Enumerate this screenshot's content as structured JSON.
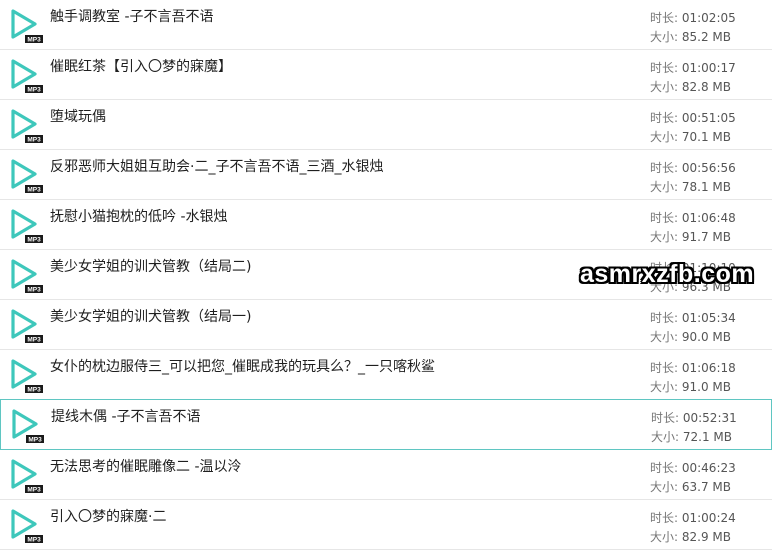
{
  "labels": {
    "duration": "时长: ",
    "size": "大小: "
  },
  "icon_badge": "MP3",
  "colors": {
    "accent": "#3ec7bb",
    "badge": "#1a1a1a",
    "selected_border": "#5fc6c2"
  },
  "files": [
    {
      "name": "触手调教室 -子不言吾不语",
      "duration": "01:02:05",
      "size": "85.2 MB"
    },
    {
      "name": "催眠红茶【引入〇梦的寐魔】",
      "duration": "01:00:17",
      "size": "82.8 MB"
    },
    {
      "name": "堕域玩偶",
      "duration": "00:51:05",
      "size": "70.1 MB"
    },
    {
      "name": "反邪恶师大姐姐互助会·二_子不言吾不语_三酒_水银烛",
      "duration": "00:56:56",
      "size": "78.1 MB"
    },
    {
      "name": "抚慰小猫抱枕的低吟 -水银烛",
      "duration": "01:06:48",
      "size": "91.7 MB"
    },
    {
      "name": "美少女学姐的训犬管教（结局二)",
      "duration": "01:10:10",
      "size": "96.3 MB"
    },
    {
      "name": "美少女学姐的训犬管教（结局一)",
      "duration": "01:05:34",
      "size": "90.0 MB"
    },
    {
      "name": "女仆的枕边服侍三_可以把您_催眠成我的玩具么？_一只喀秋鲨",
      "duration": "01:06:18",
      "size": "91.0 MB"
    },
    {
      "name": "提线木偶 -子不言吾不语",
      "duration": "00:52:31",
      "size": "72.1 MB",
      "selected": true
    },
    {
      "name": "无法思考的催眠雕像二 -温以泠",
      "duration": "00:46:23",
      "size": "63.7 MB"
    },
    {
      "name": "引入〇梦的寐魔·二",
      "duration": "01:00:24",
      "size": "82.9 MB"
    }
  ],
  "watermark": "asmrxzfb.com"
}
